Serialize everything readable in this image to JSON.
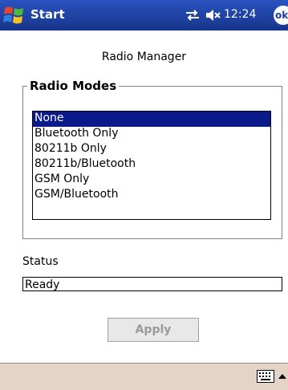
{
  "titlebar": {
    "app_name": "Start",
    "time": "12:24",
    "ok_label": "ok"
  },
  "app": {
    "title": "Radio Manager"
  },
  "radio_modes": {
    "group_label": "Radio Modes",
    "items": [
      {
        "label": "None",
        "selected": true
      },
      {
        "label": "Bluetooth Only",
        "selected": false
      },
      {
        "label": "80211b Only",
        "selected": false
      },
      {
        "label": "80211b/Bluetooth",
        "selected": false
      },
      {
        "label": "GSM Only",
        "selected": false
      },
      {
        "label": "GSM/Bluetooth",
        "selected": false
      }
    ]
  },
  "status": {
    "label": "Status",
    "value": "Ready"
  },
  "apply": {
    "label": "Apply",
    "enabled": false
  },
  "colors": {
    "titlebar": "#1d3f9e",
    "selection": "#0a1a8a",
    "menubar": "#e4d3c6"
  },
  "icons": [
    "windows-flag-icon",
    "connectivity-icon",
    "speaker-muted-icon",
    "keyboard-icon",
    "arrow-up-icon"
  ]
}
